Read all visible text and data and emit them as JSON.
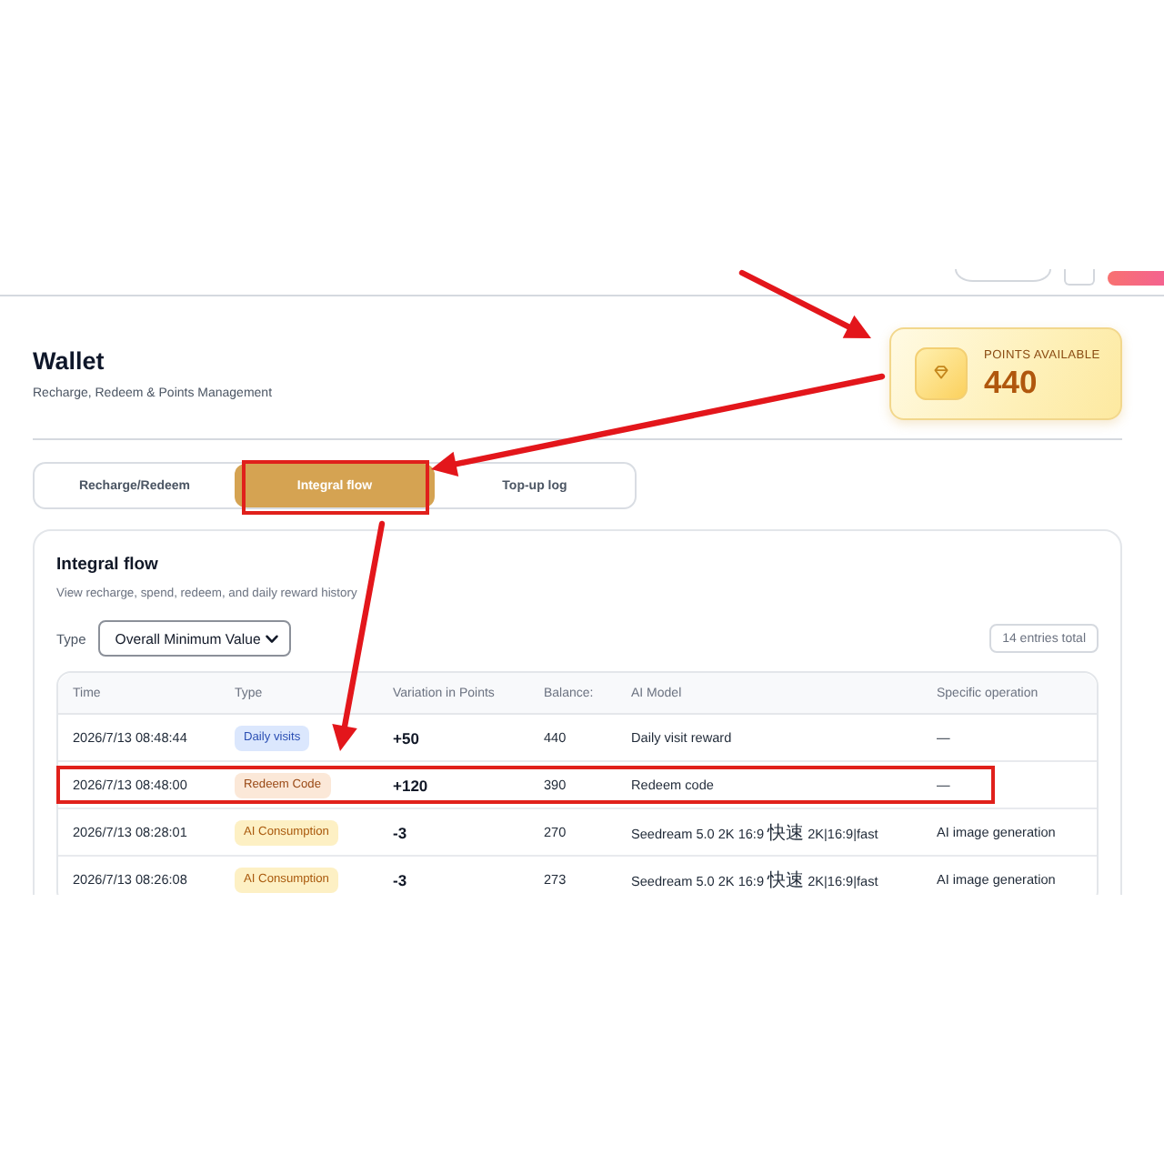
{
  "header": {
    "controls": [
      {
        "kind": "pill"
      },
      {
        "kind": "square"
      },
      {
        "kind": "primary"
      }
    ]
  },
  "page": {
    "title": "Wallet",
    "subtitle": "Recharge, Redeem & Points Management"
  },
  "points_card": {
    "label": "POINTS AVAILABLE",
    "value": "440"
  },
  "tabs": [
    {
      "label": "Recharge/Redeem",
      "selected": false,
      "highlighted": false
    },
    {
      "label": "Integral flow",
      "selected": true,
      "highlighted": true
    },
    {
      "label": "Top-up log",
      "selected": false,
      "highlighted": false
    }
  ],
  "panel": {
    "title": "Integral flow",
    "description": "View recharge, spend, redeem, and daily reward history",
    "filter": {
      "label": "Type",
      "value": "Overall Minimum Value"
    },
    "total": "14 entries total"
  },
  "table": {
    "columns": [
      "Time",
      "Type",
      "Variation in Points",
      "Balance:",
      "AI Model",
      "Specific operation"
    ],
    "rows": [
      {
        "time": "2026/7/13 08:48:44",
        "type": {
          "label": "Daily visits",
          "kind": "visit"
        },
        "variation": "+50",
        "balance": "440",
        "model": "Daily visit reward",
        "operation": "—",
        "highlighted": false
      },
      {
        "time": "2026/7/13 08:48:00",
        "type": {
          "label": "Redeem Code",
          "kind": "redeem"
        },
        "variation": "+120",
        "balance": "390",
        "model": "Redeem code",
        "operation": "—",
        "highlighted": true
      },
      {
        "time": "2026/7/13 08:28:01",
        "type": {
          "label": "AI Consumption",
          "kind": "consumption"
        },
        "variation": "-3",
        "balance": "270",
        "model": "Seedream 5.0 2K 16:9 快速 2K|16:9|fast",
        "operation": "AI image generation",
        "highlighted": false
      },
      {
        "time": "2026/7/13 08:26:08",
        "type": {
          "label": "AI Consumption",
          "kind": "consumption"
        },
        "variation": "-3",
        "balance": "273",
        "model": "Seedream 5.0 2K 16:9 快速 2K|16:9|fast",
        "operation": "AI image generation",
        "highlighted": false
      }
    ]
  },
  "annotations": [
    {
      "kind": "arrow"
    },
    {
      "kind": "arrow"
    },
    {
      "kind": "arrow"
    }
  ]
}
